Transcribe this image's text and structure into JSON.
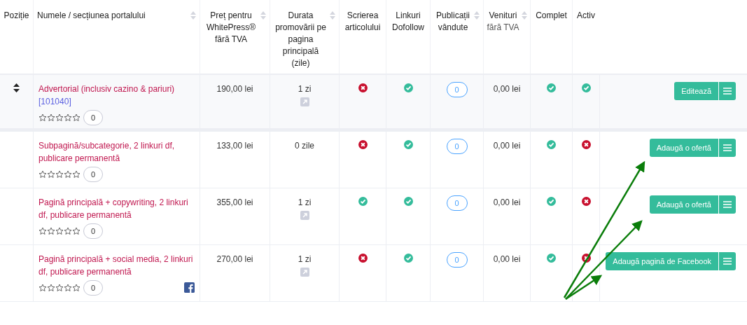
{
  "table": {
    "columns": [
      {
        "label": "Poziție",
        "sortable": false
      },
      {
        "label": "Numele / secțiunea portalului",
        "sortable": true
      },
      {
        "label": "Preț pentru WhitePress® fără TVA",
        "sortable": true
      },
      {
        "label": "Durata promovării pe pagina principală (zile)",
        "sortable": true
      },
      {
        "label": "Scrierea articolului",
        "sortable": false
      },
      {
        "label": "Linkuri Dofollow",
        "sortable": false
      },
      {
        "label": "Publicații vândute",
        "sortable": true
      },
      {
        "label": "Venituri",
        "sublabel": "fără TVA",
        "sortable": true
      },
      {
        "label": "Complet",
        "sortable": false
      },
      {
        "label": "Activ",
        "sortable": false
      }
    ],
    "rows": [
      {
        "highlighted": true,
        "draggable": true,
        "name": "Advertorial (inclusiv cazino & pariuri)",
        "id": "[101040]",
        "stars": 0,
        "reviews": "0",
        "facebook": false,
        "price": "190,00 lei",
        "duration": "1 zi",
        "duration_link": true,
        "writing": false,
        "dofollow": true,
        "sold": "0",
        "revenue": "0,00 lei",
        "complete": true,
        "active": true,
        "action": "Editează"
      },
      {
        "highlighted": false,
        "draggable": false,
        "name": "Subpagină/subcategorie, 2 linkuri df, publicare permanentă",
        "stars": 0,
        "reviews": "0",
        "facebook": false,
        "price": "133,00 lei",
        "duration": "0 zile",
        "duration_link": false,
        "writing": false,
        "dofollow": true,
        "sold": "0",
        "revenue": "0,00 lei",
        "complete": true,
        "active": false,
        "action": "Adaugă o ofertă"
      },
      {
        "highlighted": false,
        "draggable": false,
        "name": "Pagină principală + copywriting, 2 linkuri df, publicare permanentă",
        "stars": 0,
        "reviews": "0",
        "facebook": false,
        "price": "355,00 lei",
        "duration": "1 zi",
        "duration_link": true,
        "writing": true,
        "dofollow": true,
        "sold": "0",
        "revenue": "0,00 lei",
        "complete": true,
        "active": false,
        "action": "Adaugă o ofertă"
      },
      {
        "highlighted": false,
        "draggable": false,
        "name": "Pagină principală + social media, 2 linkuri df, publicare permanentă",
        "stars": 0,
        "reviews": "0",
        "facebook": true,
        "price": "270,00 lei",
        "duration": "1 zi",
        "duration_link": true,
        "writing": false,
        "dofollow": true,
        "sold": "0",
        "revenue": "0,00 lei",
        "complete": true,
        "active": false,
        "action": "Adaugă pagină de Facebook"
      }
    ]
  }
}
